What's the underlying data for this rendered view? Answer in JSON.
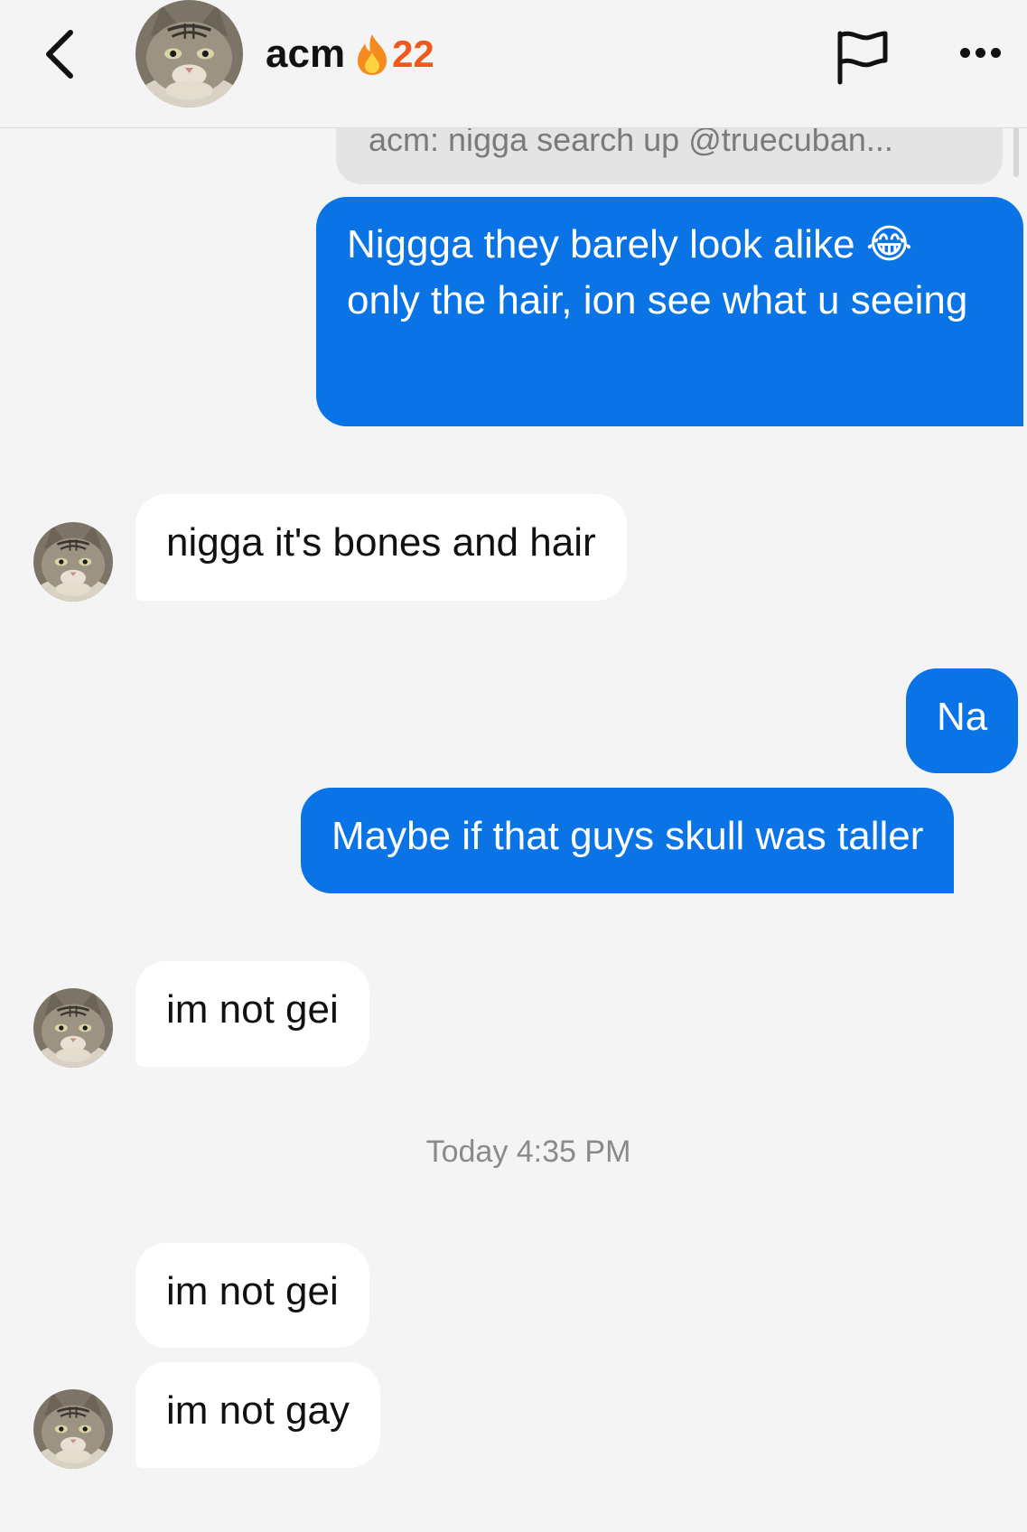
{
  "header": {
    "name": "acm",
    "streak_emoji": "🔥",
    "streak_count": "22"
  },
  "reply_preview": "acm: nigga search up @truecuban...",
  "messages": [
    {
      "from": "me",
      "text": "Niggga they barely look alike 😂 only the hair, ion see what u seeing"
    },
    {
      "from": "acm",
      "text": "nigga it's bones and hair"
    },
    {
      "from": "me",
      "text": "Na"
    },
    {
      "from": "me",
      "text": "Maybe if that guys skull was taller"
    },
    {
      "from": "acm",
      "text": "im not gei"
    },
    {
      "from": "acm",
      "text": "im not gei"
    },
    {
      "from": "acm",
      "text": "im not gay"
    }
  ],
  "timestamp": "Today 4:35 PM",
  "colors": {
    "sent_bubble": "#0a74e6",
    "received_bubble": "#ffffff",
    "background": "#f4f4f4",
    "streak": "#f0581d"
  },
  "icons": [
    "back-chevron-icon",
    "flag-icon",
    "more-icon",
    "fire-icon"
  ]
}
